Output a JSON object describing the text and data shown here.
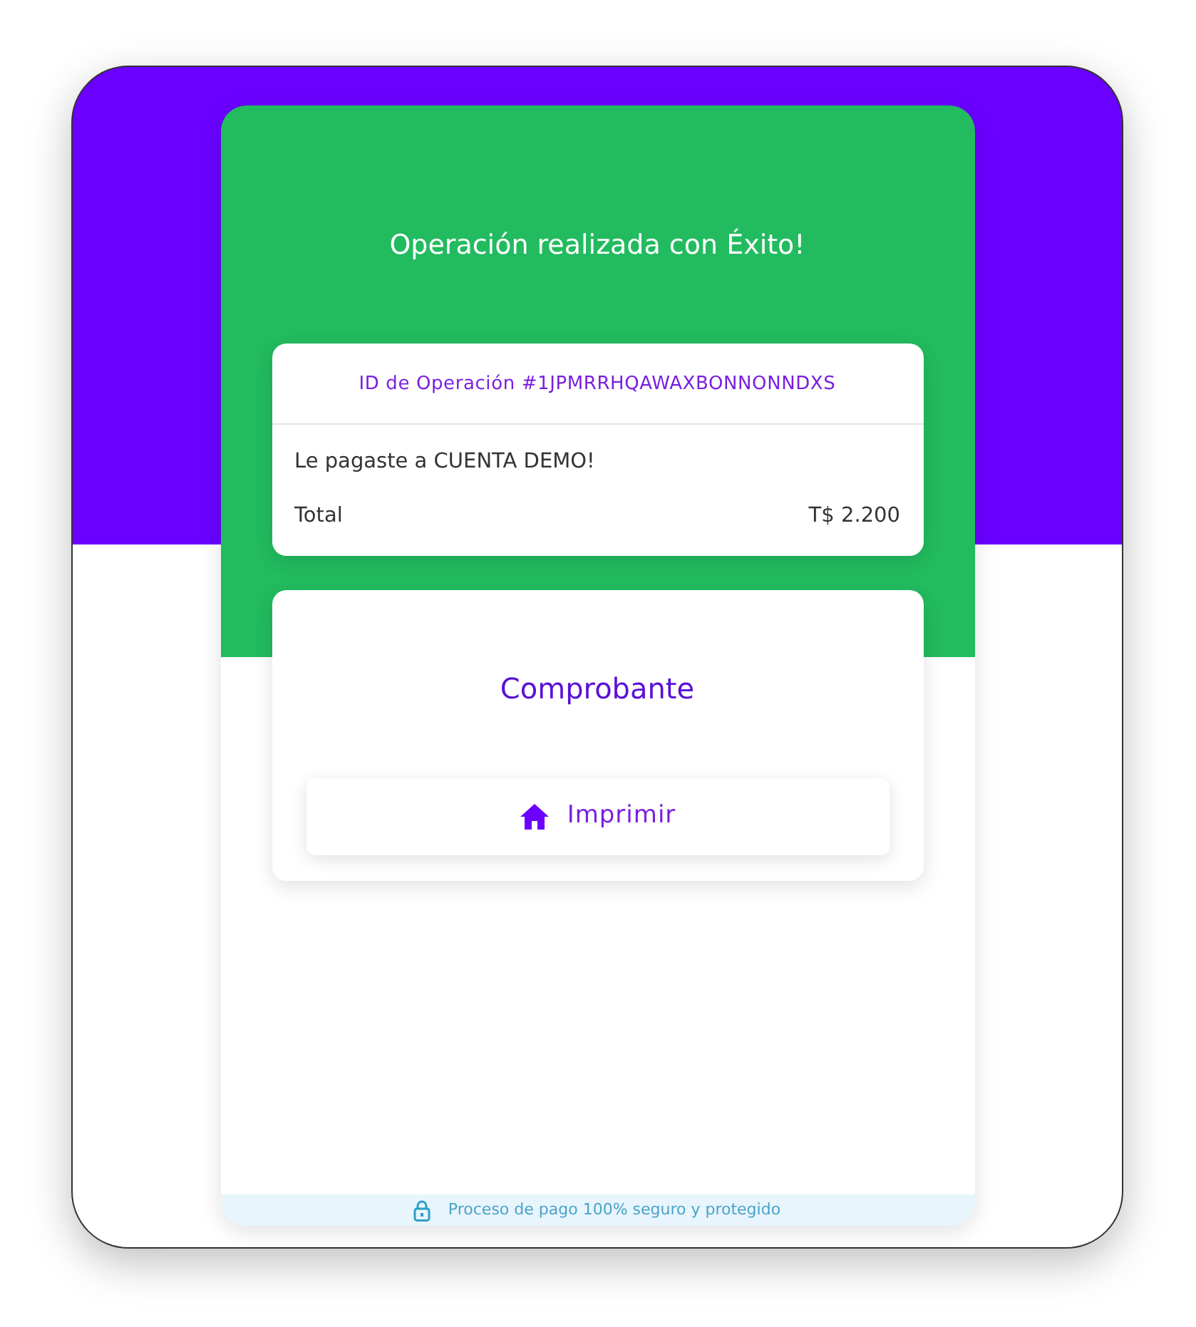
{
  "header": {
    "title": "Operación realizada con Éxito!"
  },
  "summary": {
    "operation_id": "ID de Operación #1JPMRRHQAWAXBONNONNDXS",
    "message": "Le pagaste a CUENTA DEMO!",
    "total_label": "Total",
    "total_value": "T$ 2.200"
  },
  "receipt": {
    "title": "Comprobante",
    "button": "Imprimir"
  },
  "footer": {
    "text": "Proceso de pago 100% seguro y protegido"
  }
}
